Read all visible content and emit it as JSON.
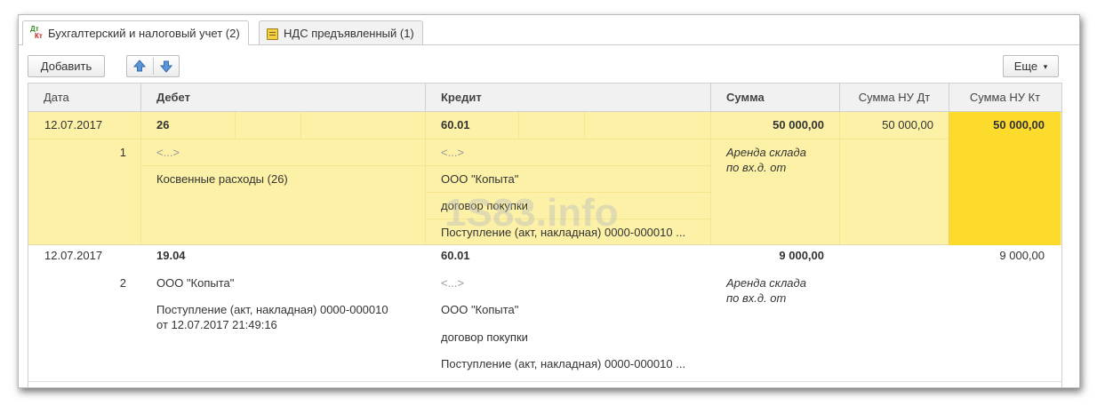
{
  "tabs": [
    {
      "label": "Бухгалтерский и налоговый учет (2)",
      "icon_text_dt": "Дт",
      "icon_text_kt": "Кт",
      "active": true
    },
    {
      "label": "НДС предъявленный (1)",
      "active": false
    }
  ],
  "toolbar": {
    "add_label": "Добавить",
    "more_label": "Еще",
    "more_arrow": "▾"
  },
  "columns": {
    "date": "Дата",
    "debit": "Дебет",
    "credit": "Кредит",
    "sum": "Сумма",
    "sum_nu_dt": "Сумма НУ Дт",
    "sum_nu_kt": "Сумма НУ Кт"
  },
  "rows": [
    {
      "date": "12.07.2017",
      "num": "1",
      "debit_account": "26",
      "debit_sub1": "<...>",
      "debit_sub2": "Косвенные расходы (26)",
      "credit_account": "60.01",
      "credit_sub1": "<...>",
      "credit_sub2": "ООО \"Копыта\"",
      "credit_sub3": "договор покупки",
      "credit_sub4": "Поступление (акт, накладная) 0000-000010 ...",
      "sum": "50 000,00",
      "content_line1": "Аренда склада",
      "content_line2": "по вх.д.  от",
      "sum_nu_dt": "50 000,00",
      "sum_nu_kt": "50 000,00"
    },
    {
      "date": "12.07.2017",
      "num": "2",
      "debit_account": "19.04",
      "debit_sub1": "ООО \"Копыта\"",
      "debit_sub2_line1": "Поступление (акт, накладная) 0000-000010",
      "debit_sub2_line2": "от 12.07.2017 21:49:16",
      "credit_account": "60.01",
      "credit_sub1": "<...>",
      "credit_sub2": "ООО \"Копыта\"",
      "credit_sub3": "договор покупки",
      "credit_sub4": "Поступление (акт, накладная) 0000-000010 ...",
      "sum": "9 000,00",
      "content_line1": "Аренда склада",
      "content_line2": "по вх.д.  от",
      "sum_nu_kt": "9 000,00"
    }
  ],
  "watermark": "1S83.info",
  "colors": {
    "selected_row": "#fcf1a6",
    "active_cell": "#fcdb2c",
    "header_bg": "#f1f1f1"
  }
}
